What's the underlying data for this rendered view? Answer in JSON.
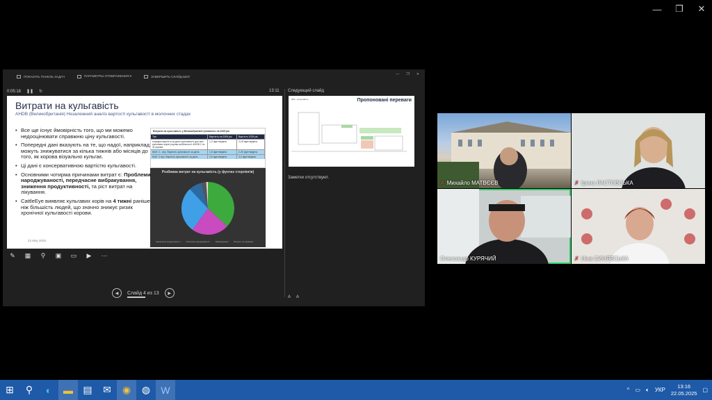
{
  "window": {
    "minimize": "—",
    "restore": "❐",
    "close": "✕"
  },
  "presenter": {
    "toolbar": [
      "ПОКАЗАТЬ ПАНЕЛЬ ЗАДАЧ",
      "ПАРАМЕТРЫ ОТОБРАЖЕНИЯ ▾",
      "ЗАВЕРШИТЬ СЛАЙД-ШОУ"
    ],
    "timer": "0:05:18",
    "clock": "13:11",
    "slide": {
      "title": "Витрати на кульгавість",
      "subtitle": "AHDB (Великобританія) Незалежний аналіз вартості кульгавості в молочних стадах",
      "bullets": [
        {
          "pre": "Все ще існує ймовірність того, що ми можемо недооцінювати справжню ціну кульгавості.",
          "bold": "",
          "post": ""
        },
        {
          "pre": "Попередні дані вказують на те, що надої, наприклад, можуть знижуватися за кілька тижнів або місяців до того, як корова візуально кульгає.",
          "bold": "",
          "post": ""
        },
        {
          "pre": "Ці дані є консервативною вартістю кульгавості.",
          "bold": "",
          "post": ""
        },
        {
          "pre": "Основними чотирма причинами витрат є: ",
          "bold": "Проблеми народжуваності, передчасне вибракування, зниження продуктивності,",
          "post": " та ріст витрат на лікування."
        },
        {
          "pre": "CattleEye виявляє кульгавих корів на ",
          "bold": "4 тижні",
          "post": " раніше, ніж більшість людей, що значно знижує ризик хронічної кульгавості корови."
        }
      ],
      "date": "22 May 2025",
      "table": {
        "title": "Витрати на кульгавість у Великобританії (оновлено на 2025 рік",
        "header": [
          "Тип",
          "Вартість на 2009 рік",
          "Вартість 2025 рік"
        ],
        "rows": [
          [
            "середня вартість за день кульгавості для всіх кульгавих корів (оцінка мобільності AHDB 2 та 3) корова",
            "1,2 фунтів/день",
            "2,18 фунтів/день"
          ],
          [
            "Моб. 2 - сер. Вартість кульгавості за день",
            "1,5 фунтів/день",
            "2,25 фунтів/день"
          ],
          [
            "Моб. 3 сер. Вартість кульгавості за день",
            "2,5 фунтів/день",
            "4,4 фунтів/день"
          ]
        ]
      },
      "pie": {
        "title": "Розбивка витрат на кульгавість (у фунтах стерлінгів)",
        "legend": [
          "Зменшення продуктивності",
          "Проблеми народжуваності",
          "Вибракування",
          "Витрати на лікування",
          "Вартість праці",
          "Витрати на власний труд"
        ],
        "slices": [
          {
            "value": 37,
            "color": "#3caa3c"
          },
          {
            "value": 23,
            "color": "#c84bc0"
          },
          {
            "value": 28,
            "color": "#3fa0e8"
          },
          {
            "value": 8,
            "color": "#2d6aa0"
          },
          {
            "value": 3,
            "color": "#555555"
          },
          {
            "value": 1,
            "color": "#e0e0e0"
          }
        ]
      }
    },
    "nav": {
      "label": "Слайд 4 из 13",
      "prev": "◀",
      "next": "▶"
    },
    "next_label": "Следующий слайд",
    "next_slide": {
      "title": "Пропоновані переваги",
      "small": "ROI – Кульгавість"
    },
    "notes": "Заметки отсутствуют.",
    "next_bottom": [
      "A",
      "A"
    ]
  },
  "participants": [
    {
      "name": "Михайло МАТВЄЄВ",
      "muted": true
    },
    {
      "name": "Ірина ЛАСТОВСЬКА",
      "muted": true
    },
    {
      "name": "Олександр КУРЯЧИЙ",
      "muted": false
    },
    {
      "name": "Ніна СИНЯВСЬКА",
      "muted": true
    }
  ],
  "taskbar": {
    "lang": "УКР",
    "time": "13:16",
    "date": "22.05.2025",
    "apps": [
      "windows-icon",
      "search-icon",
      "edge-icon",
      "explorer-icon",
      "store-icon",
      "mail-icon",
      "chrome-icon",
      "zoom-icon",
      "word-icon"
    ]
  }
}
